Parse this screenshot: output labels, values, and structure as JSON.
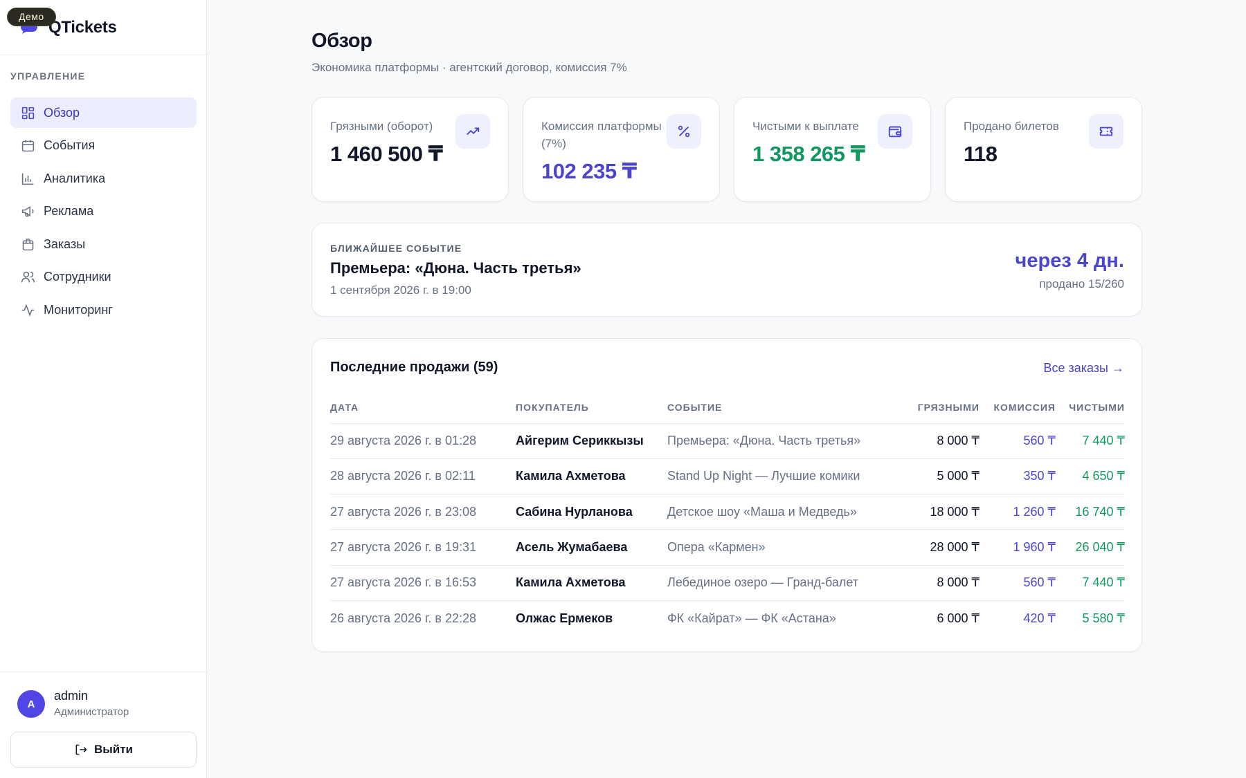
{
  "brand": {
    "name": "QTickets",
    "demo_badge": "Демо"
  },
  "sidebar": {
    "section_label": "УПРАВЛЕНИЕ",
    "items": [
      {
        "label": "Обзор",
        "icon": "dashboard-icon",
        "active": true
      },
      {
        "label": "События",
        "icon": "calendar-icon",
        "active": false
      },
      {
        "label": "Аналитика",
        "icon": "bar-chart-icon",
        "active": false
      },
      {
        "label": "Реклама",
        "icon": "megaphone-icon",
        "active": false
      },
      {
        "label": "Заказы",
        "icon": "shopping-bag-icon",
        "active": false
      },
      {
        "label": "Сотрудники",
        "icon": "users-icon",
        "active": false
      },
      {
        "label": "Мониторинг",
        "icon": "activity-icon",
        "active": false
      }
    ],
    "user": {
      "initial": "A",
      "name": "admin",
      "role": "Администратор"
    },
    "logout_label": "Выйти"
  },
  "header": {
    "title": "Обзор",
    "subtitle": "Экономика платформы · агентский договор, комиссия 7%"
  },
  "kpis": [
    {
      "label": "Грязными (оборот)",
      "value": "1 460 500 ₸",
      "icon": "trending-up-icon",
      "color": "#0f1729"
    },
    {
      "label": "Комиссия платформы (7%)",
      "value": "102 235 ₸",
      "icon": "percent-icon",
      "color": "#4b46c9"
    },
    {
      "label": "Чистыми к выплате",
      "value": "1 358 265 ₸",
      "icon": "wallet-icon",
      "color": "#10985f"
    },
    {
      "label": "Продано билетов",
      "value": "118",
      "icon": "ticket-icon",
      "color": "#0f1729"
    }
  ],
  "next_event": {
    "label": "БЛИЖАЙШЕЕ СОБЫТИЕ",
    "title": "Премьера: «Дюна. Часть третья»",
    "date": "1 сентября 2026 г. в 19:00",
    "countdown": "через 4 дн.",
    "sold": "продано 15/260"
  },
  "sales": {
    "title": "Последние продажи (59)",
    "all_orders_link": "Все заказы →",
    "columns": [
      "ДАТА",
      "ПОКУПАТЕЛЬ",
      "СОБЫТИЕ",
      "ГРЯЗНЫМИ",
      "КОМИССИЯ",
      "ЧИСТЫМИ"
    ],
    "rows": [
      {
        "date": "29 августа 2026 г. в 01:28",
        "buyer": "Айгерим Сериккызы",
        "event": "Премьера: «Дюна. Часть третья»",
        "gross": "8 000 ₸",
        "commission": "560 ₸",
        "net": "7 440 ₸"
      },
      {
        "date": "28 августа 2026 г. в 02:11",
        "buyer": "Камила Ахметова",
        "event": "Stand Up Night — Лучшие комики",
        "gross": "5 000 ₸",
        "commission": "350 ₸",
        "net": "4 650 ₸"
      },
      {
        "date": "27 августа 2026 г. в 23:08",
        "buyer": "Сабина Нурланова",
        "event": "Детское шоу «Маша и Медведь»",
        "gross": "18 000 ₸",
        "commission": "1 260 ₸",
        "net": "16 740 ₸"
      },
      {
        "date": "27 августа 2026 г. в 19:31",
        "buyer": "Асель Жумабаева",
        "event": "Опера «Кармен»",
        "gross": "28 000 ₸",
        "commission": "1 960 ₸",
        "net": "26 040 ₸"
      },
      {
        "date": "27 августа 2026 г. в 16:53",
        "buyer": "Камила Ахметова",
        "event": "Лебединое озеро — Гранд-балет",
        "gross": "8 000 ₸",
        "commission": "560 ₸",
        "net": "7 440 ₸"
      },
      {
        "date": "26 августа 2026 г. в 22:28",
        "buyer": "Олжас Ермеков",
        "event": "ФК «Кайрат» — ФК «Астана»",
        "gross": "6 000 ₸",
        "commission": "420 ₸",
        "net": "5 580 ₸"
      }
    ]
  },
  "colors": {
    "accent": "#4b46c9",
    "positive": "#10985f",
    "active_bg": "#ebedfd"
  }
}
